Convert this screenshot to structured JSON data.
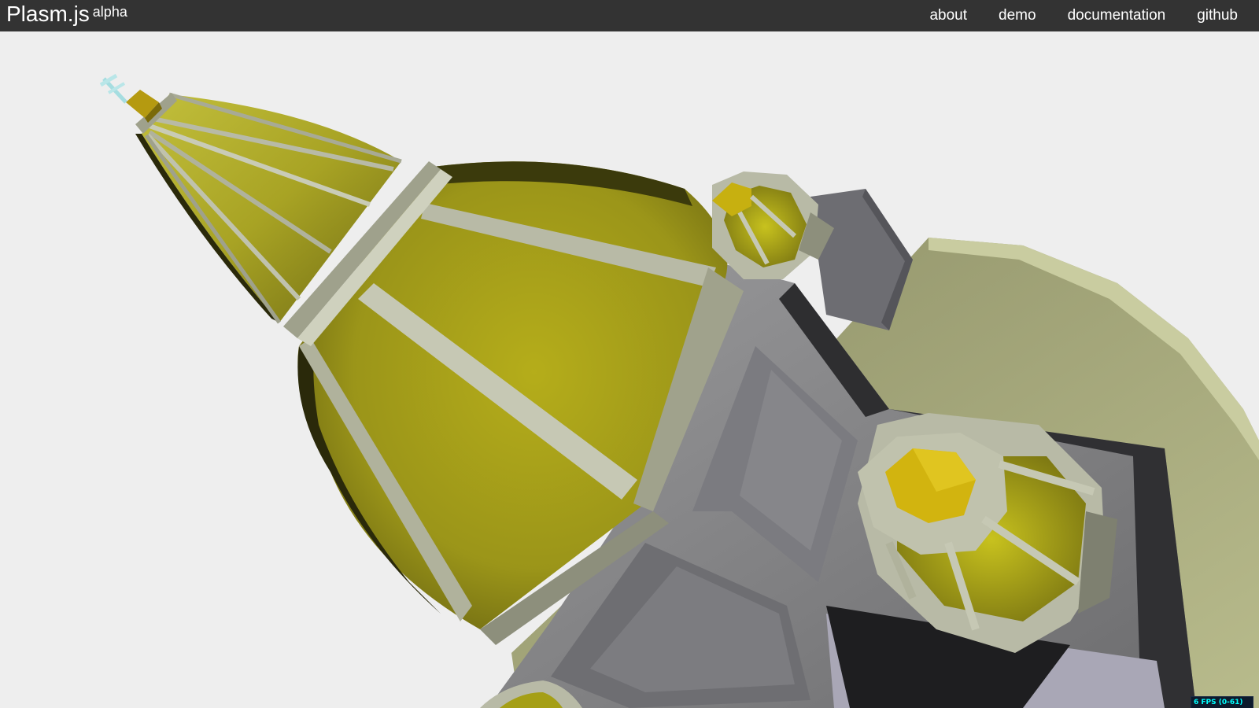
{
  "header": {
    "title": "Plasm.js",
    "title_tag": "alpha",
    "nav": [
      {
        "label": "about"
      },
      {
        "label": "demo"
      },
      {
        "label": "documentation"
      },
      {
        "label": "github"
      }
    ]
  },
  "scene": {
    "description_icon": "3d-model-canvas-icon",
    "colors": {
      "background": "#eeeeee",
      "dome_yellow": "#a6a21c",
      "dome_frame": "#b8baa6",
      "body_gray": "#8c8c8e",
      "base_plate": "#a3a67a",
      "header_bg": "#333333"
    }
  },
  "stats": {
    "fps_label": "6 FPS (0-61)",
    "fps_level": 0.1
  }
}
